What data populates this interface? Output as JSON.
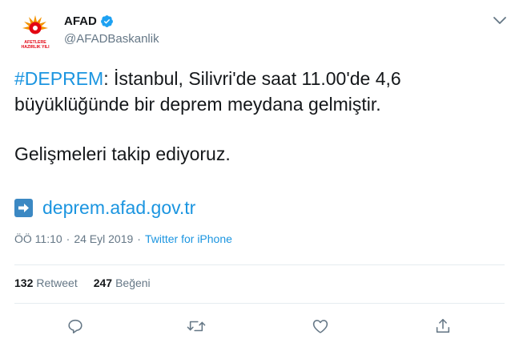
{
  "account": {
    "display_name": "AFAD",
    "handle": "@AFADBaskanlik",
    "avatar_text": "AFETLERE HAZIRLIK YILI",
    "verified": true
  },
  "tweet": {
    "hashtag": "#DEPREM",
    "line1_rest": ": İstanbul, Silivri'de saat 11.00'de 4,6",
    "line2": "büyüklüğünde bir deprem meydana gelmiştir.",
    "line3": "Gelişmeleri takip ediyoruz.",
    "link": "deprem.afad.gov.tr"
  },
  "meta": {
    "time": "ÖÖ 11:10",
    "separator": "·",
    "date": "24 Eyl 2019",
    "source": "Twitter for iPhone"
  },
  "stats": {
    "retweet_count": "132",
    "retweet_label": "Retweet",
    "like_count": "247",
    "like_label": "Beğeni"
  },
  "icons": {
    "verified": "verified-badge-icon",
    "caret": "chevron-down-icon",
    "link_arrow": "right-arrow-emoji-icon",
    "reply": "reply-icon",
    "retweet": "retweet-icon",
    "like": "heart-icon",
    "share": "share-icon"
  },
  "colors": {
    "link_blue": "#1b95e0",
    "muted_gray": "#657786",
    "text": "#14171a",
    "avatar_red": "#e30613",
    "avatar_orange": "#f39200"
  }
}
